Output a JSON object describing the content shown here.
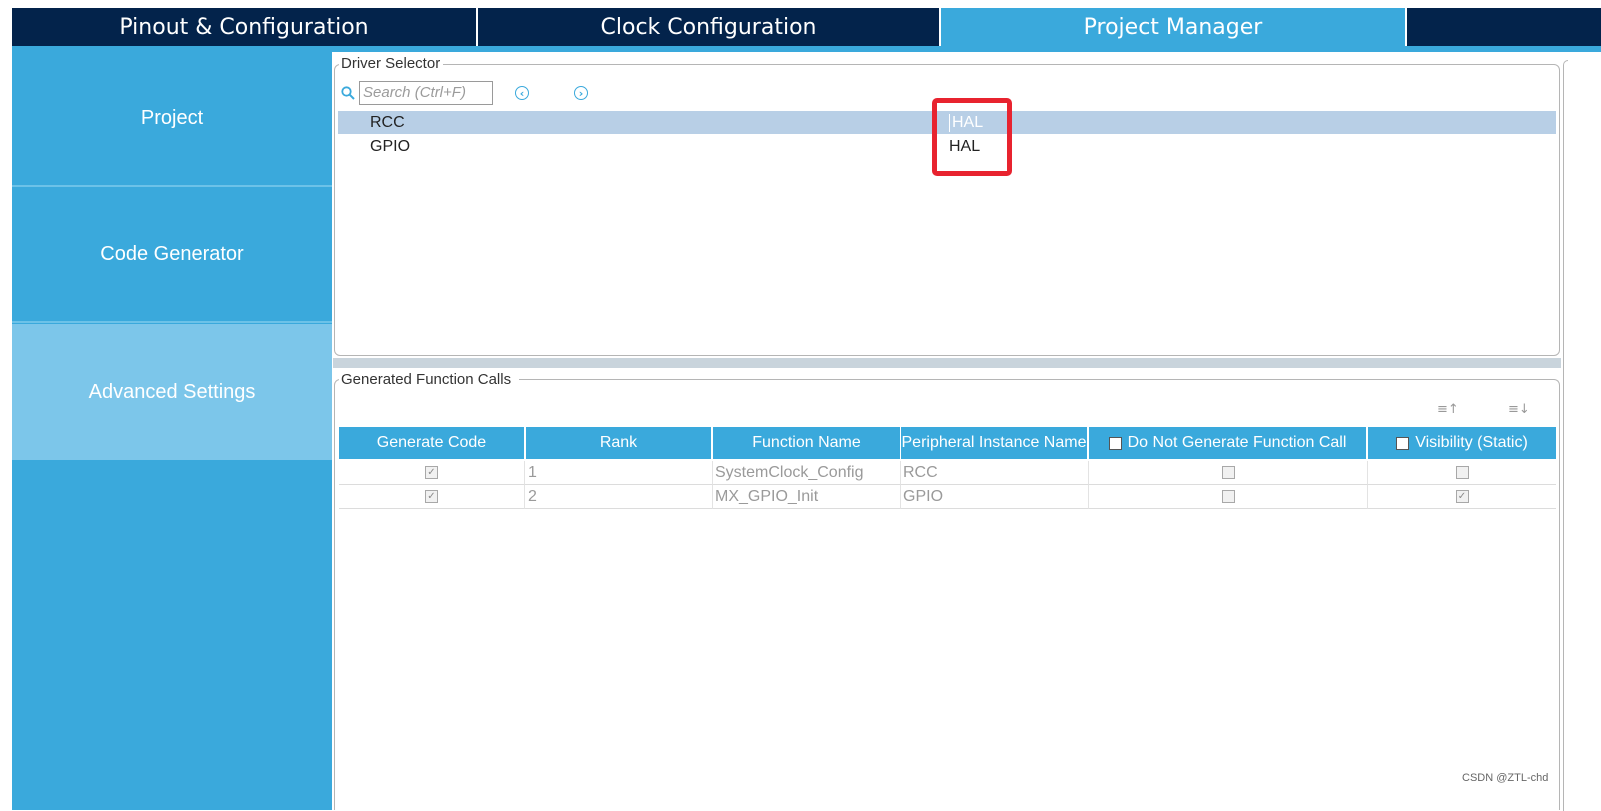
{
  "tabs": [
    "Pinout & Configuration",
    "Clock Configuration",
    "Project Manager"
  ],
  "sidebar": {
    "items": [
      "Project",
      "Code Generator",
      "Advanced Settings"
    ]
  },
  "driver_selector": {
    "legend": "Driver Selector",
    "search_placeholder": "Search (Ctrl+F)",
    "prev_icon": "chevron-left-circle-icon",
    "next_icon": "chevron-right-circle-icon",
    "rows": [
      {
        "name": "RCC",
        "value": "HAL",
        "selected": true
      },
      {
        "name": "GPIO",
        "value": "HAL",
        "selected": false
      }
    ]
  },
  "function_calls": {
    "legend": "Generated Function Calls",
    "headers": [
      "Generate Code",
      "Rank",
      "Function Name",
      "Peripheral Instance Name",
      "Do Not Generate Function Call",
      "Visibility (Static)"
    ],
    "rows": [
      {
        "generate": true,
        "rank": "1",
        "function": "SystemClock_Config",
        "peripheral": "RCC",
        "do_not_generate": false,
        "visibility_static": false
      },
      {
        "generate": true,
        "rank": "2",
        "function": "MX_GPIO_Init",
        "peripheral": "GPIO",
        "do_not_generate": false,
        "visibility_static": true
      }
    ],
    "sort_icons": [
      "sort-ascending-icon",
      "sort-descending-icon"
    ]
  },
  "watermark": "CSDN @ZTL-chd",
  "colors": {
    "navy": "#03234b",
    "accent_blue": "#3aa9dc",
    "sidebar_active": "#7cc6ea",
    "selected_row": "#b8cfe6",
    "highlight_red": "#e8232f"
  }
}
